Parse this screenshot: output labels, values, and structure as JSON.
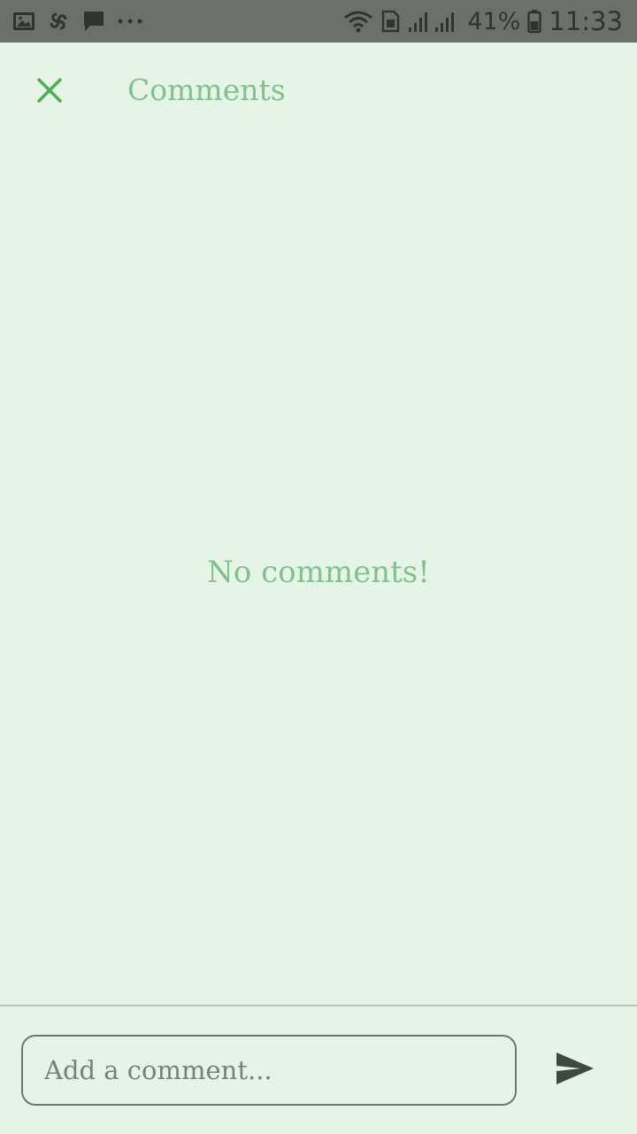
{
  "status_bar": {
    "icons_left": [
      "image-icon",
      "pinwheel-icon",
      "chat-bubble-icon",
      "more-dots-icon"
    ],
    "battery_percent": "41%",
    "time": "11:33"
  },
  "header": {
    "title": "Comments",
    "close_icon": "close-icon"
  },
  "main": {
    "empty_text": "No comments!"
  },
  "composer": {
    "placeholder": "Add a comment...",
    "value": "",
    "send_icon": "send-icon"
  },
  "colors": {
    "background": "#e6f4e8",
    "accent_green": "#4caf50",
    "title_green": "#7cc487",
    "status_bar": "#6b706c"
  }
}
